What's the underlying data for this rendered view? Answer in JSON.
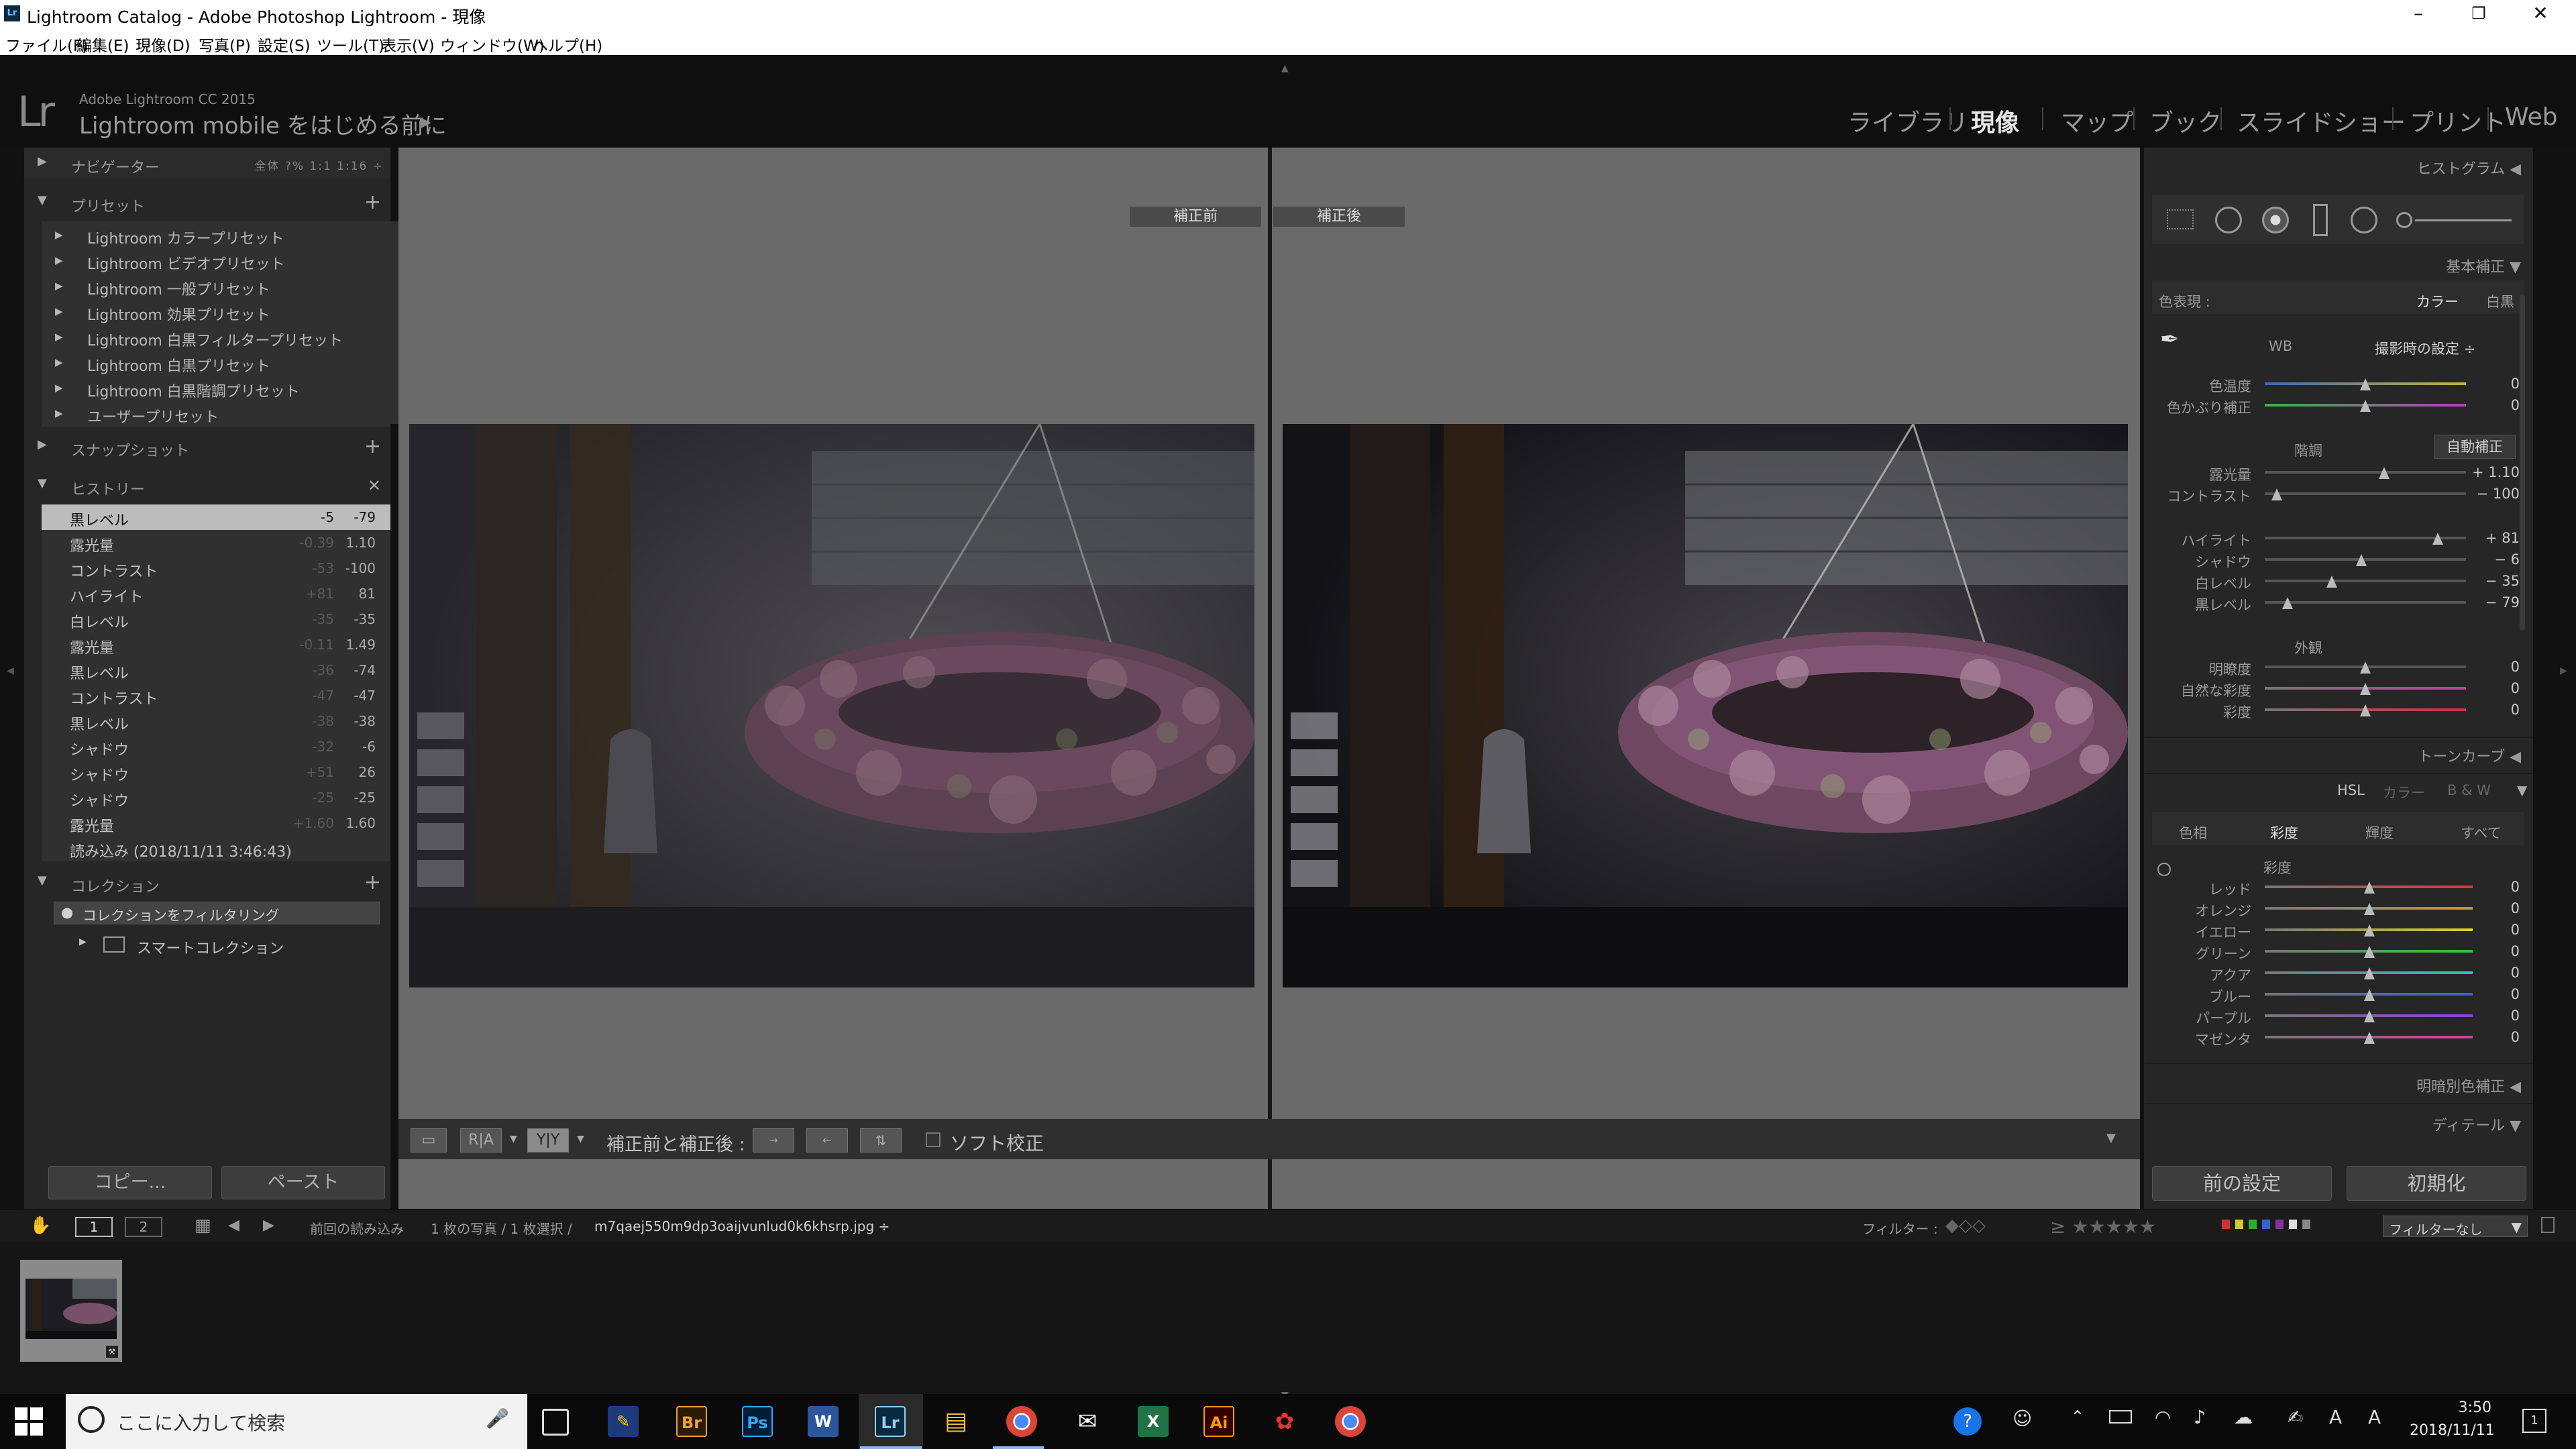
{
  "window": {
    "title": "Lightroom Catalog - Adobe Photoshop Lightroom - 現像",
    "app_icon": "Lr"
  },
  "menu": [
    "ファイル(F)",
    "編集(E)",
    "現像(D)",
    "写真(P)",
    "設定(S)",
    "ツール(T)",
    "表示(V)",
    "ウィンドウ(W)",
    "ヘルプ(H)"
  ],
  "identity": {
    "logo": "Lr",
    "version": "Adobe Lightroom CC 2015",
    "mobile": "Lightroom mobile をはじめる前に"
  },
  "modules": [
    "ライブラリ",
    "現像",
    "マップ",
    "ブック",
    "スライドショー",
    "プリント",
    "Web"
  ],
  "active_module": "現像",
  "left": {
    "navigator": {
      "label": "ナビゲーター",
      "zoom": "全体  ?%  1:1  1:16 ÷"
    },
    "presets": {
      "label": "プリセット",
      "items": [
        "Lightroom カラープリセット",
        "Lightroom ビデオプリセット",
        "Lightroom 一般プリセット",
        "Lightroom 効果プリセット",
        "Lightroom 白黒フィルタープリセット",
        "Lightroom 白黒プリセット",
        "Lightroom 白黒階調プリセット",
        "ユーザープリセット"
      ]
    },
    "snapshot": {
      "label": "スナップショット"
    },
    "history": {
      "label": "ヒストリー",
      "items": [
        {
          "name": "黒レベル",
          "delta": "-5",
          "value": "-79"
        },
        {
          "name": "露光量",
          "delta": "-0.39",
          "value": "1.10"
        },
        {
          "name": "コントラスト",
          "delta": "-53",
          "value": "-100"
        },
        {
          "name": "ハイライト",
          "delta": "+81",
          "value": "81"
        },
        {
          "name": "白レベル",
          "delta": "-35",
          "value": "-35"
        },
        {
          "name": "露光量",
          "delta": "-0.11",
          "value": "1.49"
        },
        {
          "name": "黒レベル",
          "delta": "-36",
          "value": "-74"
        },
        {
          "name": "コントラスト",
          "delta": "-47",
          "value": "-47"
        },
        {
          "name": "黒レベル",
          "delta": "-38",
          "value": "-38"
        },
        {
          "name": "シャドウ",
          "delta": "-32",
          "value": "-6"
        },
        {
          "name": "シャドウ",
          "delta": "+51",
          "value": "26"
        },
        {
          "name": "シャドウ",
          "delta": "-25",
          "value": "-25"
        },
        {
          "name": "露光量",
          "delta": "+1.60",
          "value": "1.60"
        },
        {
          "name": "読み込み (2018/11/11 3:46:43)",
          "delta": "",
          "value": ""
        }
      ]
    },
    "collections": {
      "label": "コレクション",
      "filter": "コレクションをフィルタリング",
      "smart": "スマートコレクション"
    },
    "copy": "コピー...",
    "paste": "ペースト"
  },
  "center": {
    "before_label": "補正前",
    "after_label": "補正後",
    "toolbar": {
      "before_after": "補正前と補正後 :",
      "softproof": "ソフト校正",
      "ra": "R|A",
      "yy": "Y|Y"
    }
  },
  "right": {
    "histogram": "ヒストグラム",
    "basic": "基本補正",
    "treatment_label": "色表現 :",
    "treatment": [
      "カラー",
      "白黒"
    ],
    "wb_label": "WB",
    "wb_value": "撮影時の設定 ÷",
    "wb_sliders": [
      {
        "name": "色温度",
        "value": "0"
      },
      {
        "name": "色かぶり補正",
        "value": "0"
      }
    ],
    "tone_label": "階調",
    "auto": "自動補正",
    "tone_sliders": [
      {
        "name": "露光量",
        "value": "+ 1.10",
        "pos": 0.72
      },
      {
        "name": "コントラスト",
        "value": "− 100",
        "pos": 0.0
      }
    ],
    "tone_sliders2": [
      {
        "name": "ハイライト",
        "value": "+ 81",
        "pos": 0.905
      },
      {
        "name": "シャドウ",
        "value": "− 6",
        "pos": 0.47
      },
      {
        "name": "白レベル",
        "value": "− 35",
        "pos": 0.325
      },
      {
        "name": "黒レベル",
        "value": "− 79",
        "pos": 0.105
      }
    ],
    "presence_label": "外観",
    "presence_sliders": [
      {
        "name": "明瞭度",
        "value": "0"
      },
      {
        "name": "自然な彩度",
        "value": "0"
      },
      {
        "name": "彩度",
        "value": "0"
      }
    ],
    "tonecurve": "トーンカーブ",
    "hsl_tabs": [
      "HSL",
      "カラー",
      "B & W"
    ],
    "hsl_sub": [
      "色相",
      "彩度",
      "輝度",
      "すべて"
    ],
    "hsl_active": "彩度",
    "hsl_title": "彩度",
    "hsl_sliders": [
      {
        "name": "レッド",
        "value": "0"
      },
      {
        "name": "オレンジ",
        "value": "0"
      },
      {
        "name": "イエロー",
        "value": "0"
      },
      {
        "name": "グリーン",
        "value": "0"
      },
      {
        "name": "アクア",
        "value": "0"
      },
      {
        "name": "ブルー",
        "value": "0"
      },
      {
        "name": "パープル",
        "value": "0"
      },
      {
        "name": "マゼンタ",
        "value": "0"
      }
    ],
    "split": "明暗別色補正",
    "detail": "ディテール",
    "prev": "前の設定",
    "reset": "初期化"
  },
  "filmstrip": {
    "page1": "1",
    "page2": "2",
    "source": "前回の読み込み",
    "info": "1 枚の写真 / 1 枚選択 /",
    "file": "m7qaej550m9dp3oaijvunlud0k6khsrp.jpg ÷",
    "filter_label": "フィルター :",
    "filter_value": "フィルターなし"
  },
  "taskbar": {
    "search_placeholder": "ここに入力して検索",
    "apps": [
      "Br",
      "Ps",
      "W",
      "Lr",
      "X",
      "Ai"
    ],
    "time": "3:50",
    "date": "2018/11/11",
    "notif": "1"
  }
}
